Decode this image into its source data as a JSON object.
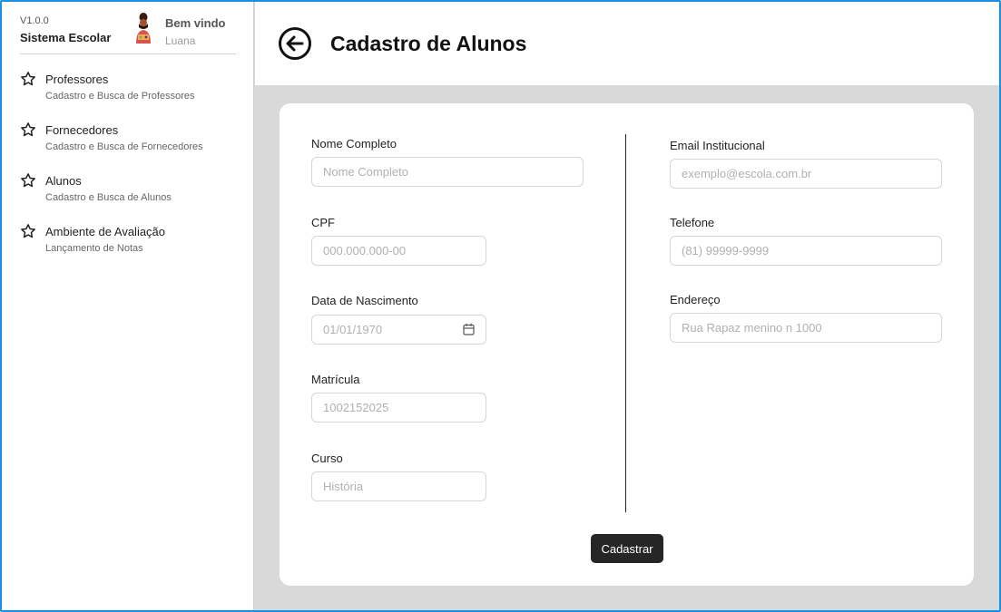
{
  "app": {
    "version": "V1.0.0",
    "name": "Sistema Escolar",
    "welcome": "Bem vindo",
    "user_name": "Luana"
  },
  "sidebar": {
    "items": [
      {
        "label": "Professores",
        "sub": "Cadastro e Busca de Professores",
        "icon": "star-icon"
      },
      {
        "label": "Fornecedores",
        "sub": "Cadastro e Busca de Fornecedores",
        "icon": "star-icon"
      },
      {
        "label": "Alunos",
        "sub": "Cadastro e Busca de Alunos",
        "icon": "star-icon"
      },
      {
        "label": "Ambiente de Avaliação",
        "sub": "Lançamento de Notas",
        "icon": "star-icon"
      }
    ]
  },
  "header": {
    "title": "Cadastro de Alunos",
    "back_icon": "arrow-left-circle-icon"
  },
  "form": {
    "nome": {
      "label": "Nome Completo",
      "placeholder": "Nome Completo"
    },
    "cpf": {
      "label": "CPF",
      "placeholder": "000.000.000-00"
    },
    "nascimento": {
      "label": "Data de Nascimento",
      "placeholder": "01/01/1970"
    },
    "matricula": {
      "label": "Matrícula",
      "placeholder": "1002152025"
    },
    "curso": {
      "label": "Curso",
      "placeholder": "História"
    },
    "email": {
      "label": "Email Institucional",
      "placeholder": "exemplo@escola.com.br"
    },
    "telefone": {
      "label": "Telefone",
      "placeholder": "(81) 99999-9999"
    },
    "endereco": {
      "label": "Endereço",
      "placeholder": "Rua Rapaz menino n 1000"
    },
    "submit_label": "Cadastrar"
  },
  "colors": {
    "frame_border": "#1a8fe3",
    "background": "#d9d9d9",
    "button": "#262626"
  }
}
